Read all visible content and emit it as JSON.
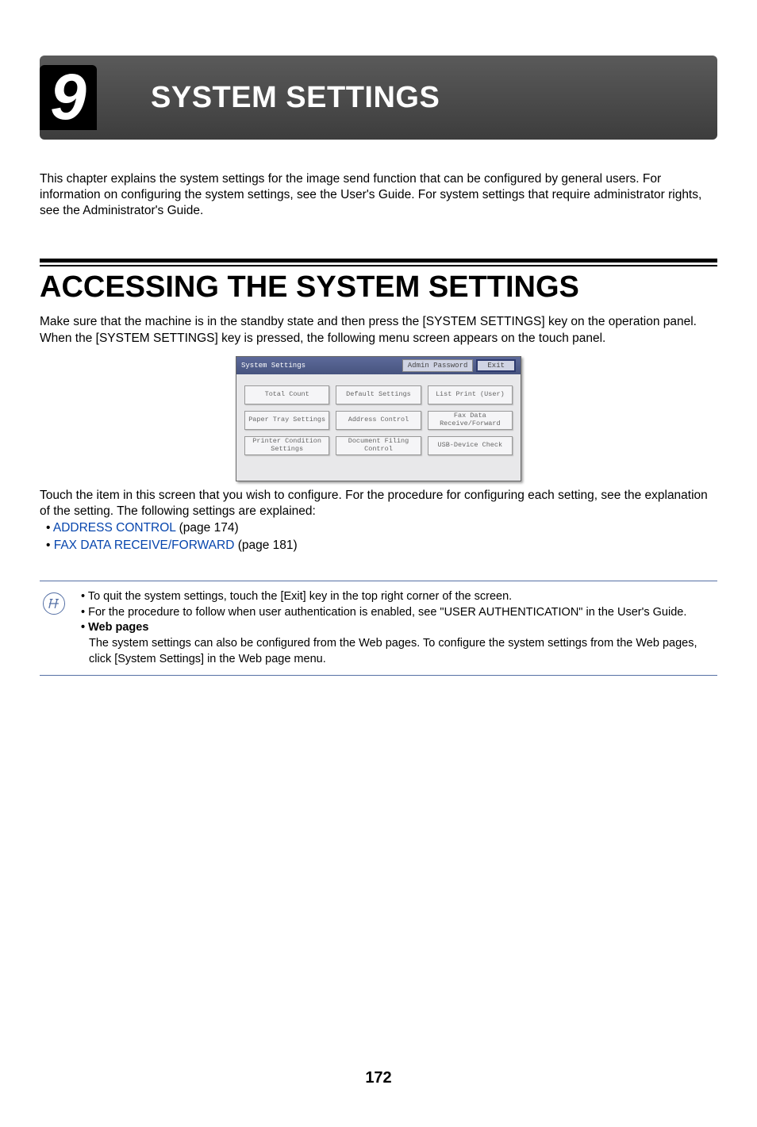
{
  "chapter": {
    "number": "9",
    "title": "SYSTEM SETTINGS"
  },
  "intro": "This chapter explains the system settings for the image send function that can be configured by general users. For information on configuring the system settings, see the User's Guide. For system settings that require administrator rights, see the Administrator's Guide.",
  "section": {
    "title": "ACCESSING THE SYSTEM SETTINGS",
    "para1": "Make sure that the machine is in the standby state and then press the [SYSTEM SETTINGS] key on the operation panel.",
    "para2": "When the [SYSTEM SETTINGS] key is pressed, the following menu screen appears on the touch panel."
  },
  "panel": {
    "header_title": "System Settings",
    "admin_btn": "Admin Password",
    "exit_btn": "Exit",
    "buttons": {
      "r1c1": "Total Count",
      "r1c2": "Default Settings",
      "r1c3": "List Print (User)",
      "r2c1": "Paper Tray Settings",
      "r2c2": "Address Control",
      "r2c3": "Fax Data Receive/Forward",
      "r3c1": "Printer Condition Settings",
      "r3c2": "Document Filing Control",
      "r3c3": "USB-Device Check"
    }
  },
  "post": {
    "para": "Touch the item in this screen that you wish to configure. For the procedure for configuring each setting, see the explanation of the setting. The following settings are explained:",
    "bullet1_link": "ADDRESS CONTROL",
    "bullet1_page": " (page 174)",
    "bullet2_link": "FAX DATA RECEIVE/FORWARD",
    "bullet2_page": " (page 181)"
  },
  "note": {
    "b1": "• To quit the system settings, touch the [Exit] key in the top right corner of the screen.",
    "b2": "• For the procedure to follow when user authentication is enabled, see \"USER AUTHENTICATION\" in the User's Guide.",
    "b3_label": "• Web pages",
    "b3_text": "The system settings can also be configured from the Web pages. To configure the system settings from the Web pages, click [System Settings] in the Web page menu."
  },
  "page_number": "172"
}
